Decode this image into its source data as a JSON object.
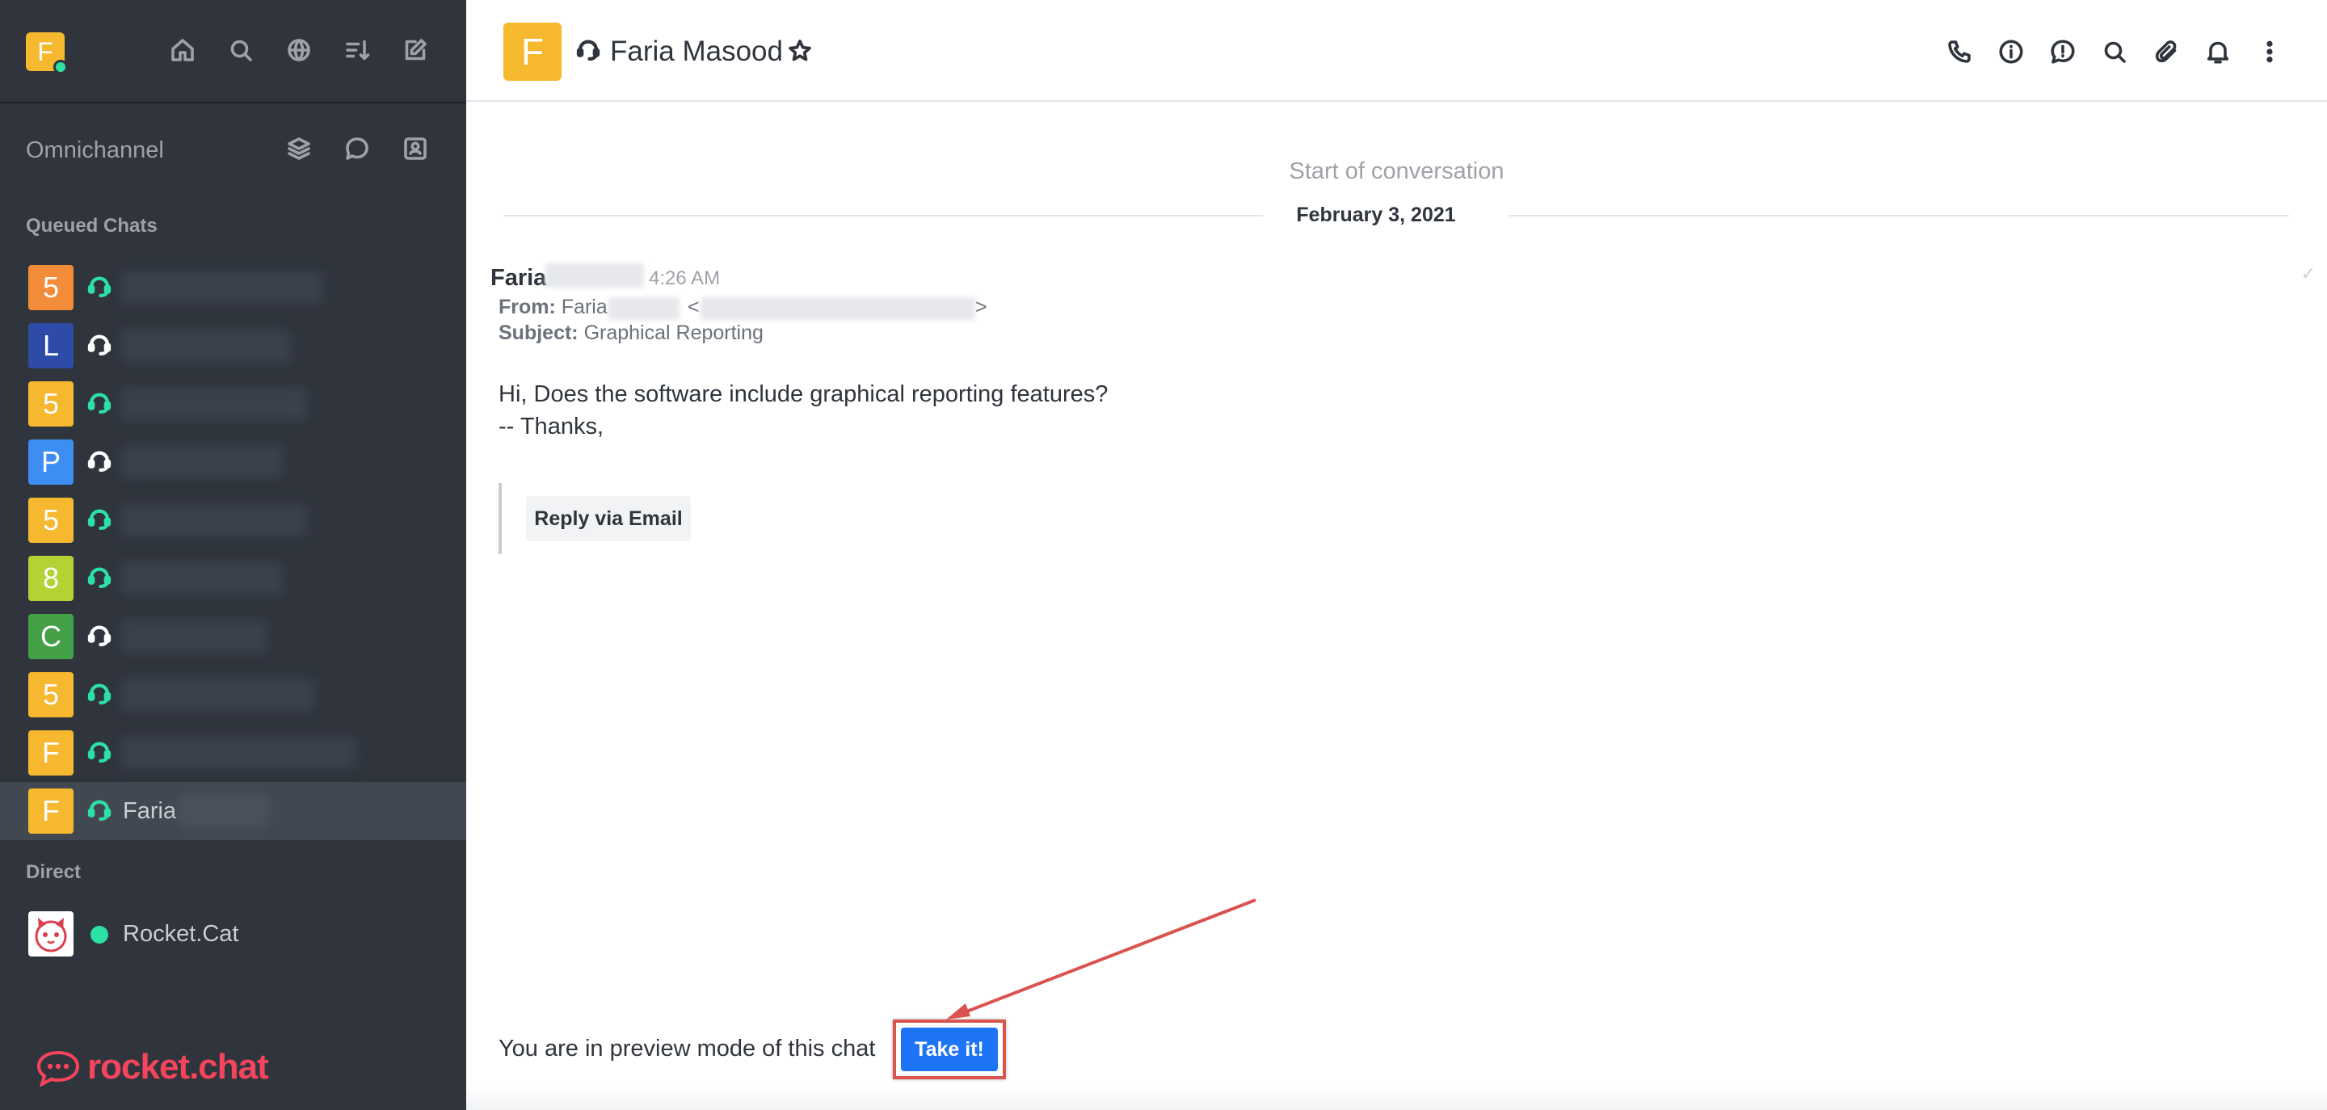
{
  "user": {
    "initial": "F"
  },
  "sidebar": {
    "top_icons": [
      "home-icon",
      "search-icon",
      "directory-icon",
      "sort-icon",
      "create-new-icon"
    ],
    "omnichannel": {
      "label": "Omnichannel",
      "icons": [
        "queue-icon",
        "chat-icon",
        "contact-center-icon"
      ]
    },
    "queued_title": "Queued Chats",
    "queued": [
      {
        "initial": "5",
        "color": "#f38c39",
        "agent_color": "#2de0a5",
        "name": ""
      },
      {
        "initial": "L",
        "color": "#2e4ba8",
        "agent_color": "#ffffff",
        "name": ""
      },
      {
        "initial": "5",
        "color": "#f5b82f",
        "agent_color": "#2de0a5",
        "name": ""
      },
      {
        "initial": "P",
        "color": "#3d8ef0",
        "agent_color": "#ffffff",
        "name": ""
      },
      {
        "initial": "5",
        "color": "#f5b82f",
        "agent_color": "#2de0a5",
        "name": ""
      },
      {
        "initial": "8",
        "color": "#b3d334",
        "agent_color": "#2de0a5",
        "name": ""
      },
      {
        "initial": "C",
        "color": "#43a047",
        "agent_color": "#ffffff",
        "name": ""
      },
      {
        "initial": "5",
        "color": "#f5b82f",
        "agent_color": "#2de0a5",
        "name": ""
      },
      {
        "initial": "F",
        "color": "#f5b82f",
        "agent_color": "#2de0a5",
        "name": ""
      },
      {
        "initial": "F",
        "color": "#f5b82f",
        "agent_color": "#2de0a5",
        "name": "Faria"
      }
    ],
    "direct_title": "Direct",
    "direct": [
      {
        "name": "Rocket.Cat",
        "status_color": "#2de0a5"
      }
    ],
    "logo_text": "rocket.chat"
  },
  "header": {
    "initial": "F",
    "title": "Faria Masood",
    "icons": [
      "phone-icon",
      "info-icon",
      "alert-icon",
      "search-icon",
      "attachment-icon",
      "bell-icon",
      "kebab-icon"
    ]
  },
  "conversation": {
    "start_label": "Start of conversation",
    "date": "February 3, 2021",
    "sender": "Faria",
    "time": "4:26 AM",
    "from_label": "From:",
    "from_value": "Faria",
    "subject_label": "Subject:",
    "subject_value": "Graphical Reporting",
    "body_line1": "Hi, Does the software include graphical reporting features?",
    "body_line2": "-- Thanks,",
    "reply_label": "Reply via Email"
  },
  "footer": {
    "preview_text": "You are in preview mode of this chat",
    "take_label": "Take it!"
  },
  "colors": {
    "sidebar_bg": "#2f343d",
    "accent": "#1d74f5",
    "brand": "#f5455c",
    "annotation": "#d9534f"
  }
}
